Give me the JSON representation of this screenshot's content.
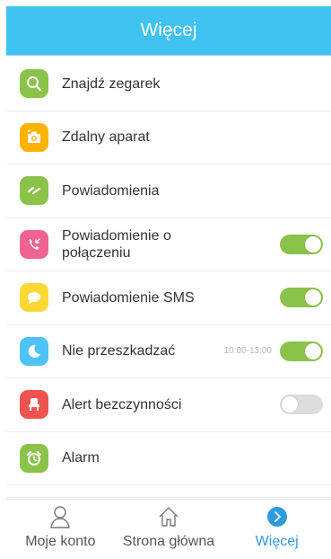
{
  "colors": {
    "header_bg": "#3fc1f2",
    "toggle_on": "#8bc34a",
    "toggle_off": "#dcdcdc",
    "active_tab": "#2e9ae0"
  },
  "header": {
    "title": "Więcej"
  },
  "menu": [
    {
      "label": "Znajdź zegarek",
      "icon": "search-icon",
      "icon_color": "#8bc34a"
    },
    {
      "label": "Zdalny aparat",
      "icon": "camera-icon",
      "icon_color": "#ffb300"
    },
    {
      "label": "Powiadomienia",
      "icon": "notification-icon",
      "icon_color": "#8bc34a"
    },
    {
      "label": "Powiadomienie o połączeniu",
      "icon": "incoming-call-icon",
      "icon_color": "#f06292",
      "toggle": true
    },
    {
      "label": "Powiadomienie SMS",
      "icon": "message-icon",
      "icon_color": "#fdd835",
      "toggle": true
    },
    {
      "label": "Nie przeszkadzać",
      "icon": "moon-icon",
      "icon_color": "#4fc3f7",
      "time": "10:00-13:00",
      "toggle": true
    },
    {
      "label": "Alert bezczynności",
      "icon": "chair-icon",
      "icon_color": "#ef5350",
      "toggle": false
    },
    {
      "label": "Alarm",
      "icon": "alarm-clock-icon",
      "icon_color": "#8bc34a"
    }
  ],
  "tabs": [
    {
      "label": "Moje konto",
      "icon": "person-icon",
      "active": false
    },
    {
      "label": "Strona główna",
      "icon": "home-icon",
      "active": false
    },
    {
      "label": "Więcej",
      "icon": "chevron-right-icon",
      "active": true
    }
  ]
}
